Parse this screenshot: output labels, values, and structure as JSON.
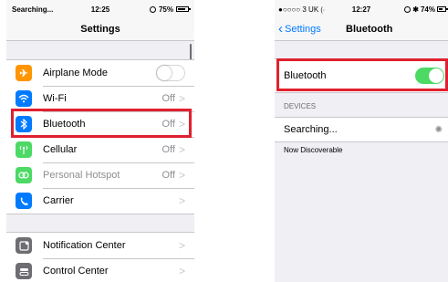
{
  "left": {
    "status": {
      "carrier": "Searching...",
      "time": "12:25",
      "battery": "75%",
      "battery_level": 0.75
    },
    "nav_title": "Settings",
    "group1": [
      {
        "icon": "airplane-icon",
        "label": "Airplane Mode",
        "color": "#ff9500"
      },
      {
        "icon": "wifi-icon",
        "label": "Wi-Fi",
        "value": "Off",
        "color": "#007aff"
      },
      {
        "icon": "bluetooth-icon",
        "label": "Bluetooth",
        "value": "Off",
        "color": "#007aff"
      },
      {
        "icon": "cellular-icon",
        "label": "Cellular",
        "value": "Off",
        "color": "#4cd964"
      },
      {
        "icon": "hotspot-icon",
        "label": "Personal Hotspot",
        "value": "Off",
        "color": "#4cd964"
      },
      {
        "icon": "carrier-icon",
        "label": "Carrier",
        "color": "#007aff"
      }
    ],
    "group2": [
      {
        "icon": "notification-center-icon",
        "label": "Notification Center",
        "color": "#8e8e93"
      },
      {
        "icon": "control-center-icon",
        "label": "Control Center",
        "color": "#8e8e93"
      }
    ]
  },
  "right": {
    "status": {
      "carrier": "●○○○○ 3 UK",
      "time": "12:27",
      "battery": "74%",
      "battery_level": 0.74
    },
    "back_label": "Settings",
    "nav_title": "Bluetooth",
    "bluetooth_label": "Bluetooth",
    "devices_header": "DEVICES",
    "searching_label": "Searching...",
    "discoverable_text": "Now Discoverable"
  },
  "colors": {
    "highlight": "#e0202e",
    "toggle_on": "#4cd964",
    "link": "#007aff"
  }
}
